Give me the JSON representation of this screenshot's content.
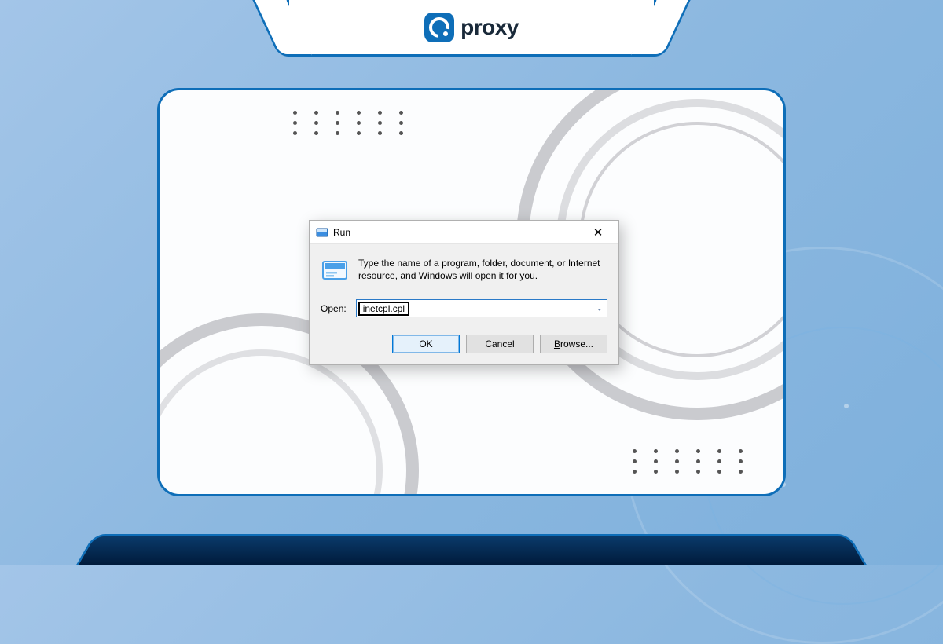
{
  "brand": {
    "name": "proxy"
  },
  "run_dialog": {
    "title": "Run",
    "description": "Type the name of a program, folder, document, or Internet resource, and Windows will open it for you.",
    "open_label_prefix": "O",
    "open_label_rest": "pen:",
    "input_value": "inetcpl.cpl",
    "buttons": {
      "ok": "OK",
      "cancel": "Cancel",
      "browse_prefix": "B",
      "browse_rest": "rowse..."
    }
  }
}
